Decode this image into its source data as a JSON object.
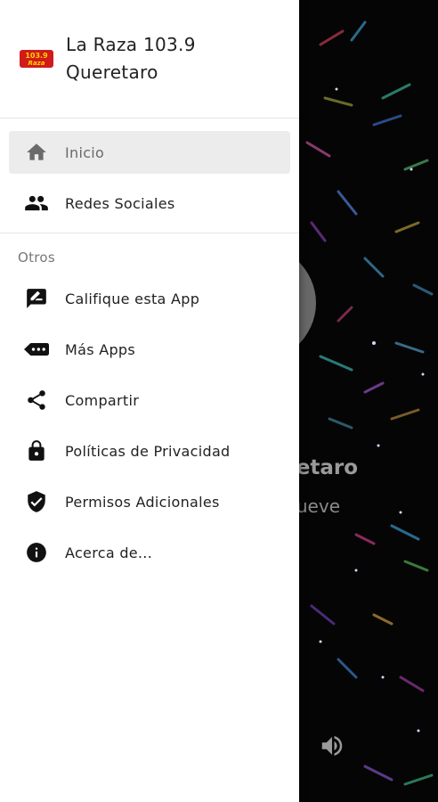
{
  "app": {
    "title_line1": "La Raza 103.9",
    "title_line2": "Queretaro",
    "logo_text": "103.9 Raza"
  },
  "nav": {
    "primary": [
      {
        "label": "Inicio",
        "icon": "home-icon",
        "active": true
      },
      {
        "label": "Redes Sociales",
        "icon": "people-icon",
        "active": false
      }
    ],
    "section_label": "Otros",
    "secondary": [
      {
        "label": "Califique esta App",
        "icon": "rate-icon"
      },
      {
        "label": "Más Apps",
        "icon": "more-apps-icon"
      },
      {
        "label": "Compartir",
        "icon": "share-icon"
      },
      {
        "label": "Políticas de Privacidad",
        "icon": "lock-icon"
      },
      {
        "label": "Permisos Adicionales",
        "icon": "shield-check-icon"
      },
      {
        "label": "Acerca de...",
        "icon": "info-icon"
      }
    ]
  },
  "background": {
    "station_partial": "etaro",
    "subtitle_partial": "ueve"
  },
  "colors": {
    "drawer_bg": "#ffffff",
    "active_item_bg": "#ececec",
    "background_app": "#050505"
  }
}
